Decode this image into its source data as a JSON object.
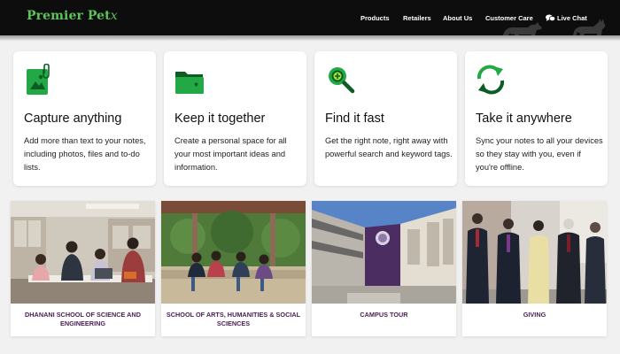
{
  "brand": {
    "name": "Premier Pet",
    "swash": "x",
    "color": "#5ec35c"
  },
  "nav": {
    "items": [
      "Products",
      "Retailers",
      "About Us",
      "Customer Care"
    ],
    "chat_label": "Live Chat"
  },
  "features": [
    {
      "icon": "photo-attachment-icon",
      "title": "Capture anything",
      "text": "Add more than text to your notes, including photos, files and to-do lists."
    },
    {
      "icon": "folder-heart-icon",
      "title": "Keep it together",
      "text": "Create a personal space for all your most important ideas and information."
    },
    {
      "icon": "magnify-icon",
      "title": "Find it fast",
      "text": "Get the right note, right away with powerful search and keyword tags."
    },
    {
      "icon": "sync-icon",
      "title": "Take it anywhere",
      "text": "Sync your notes to all your devices so they stay with you, even if you're offline."
    }
  ],
  "photo_cards": [
    {
      "label": "Dhanani School of Science and Engineering"
    },
    {
      "label": "School of Arts, Humanities & Social Sciences"
    },
    {
      "label": "Campus Tour"
    },
    {
      "label": "Giving"
    }
  ],
  "colors": {
    "accent": "#22a845",
    "caption": "#4b1d55",
    "header": "#0d0d0d"
  }
}
